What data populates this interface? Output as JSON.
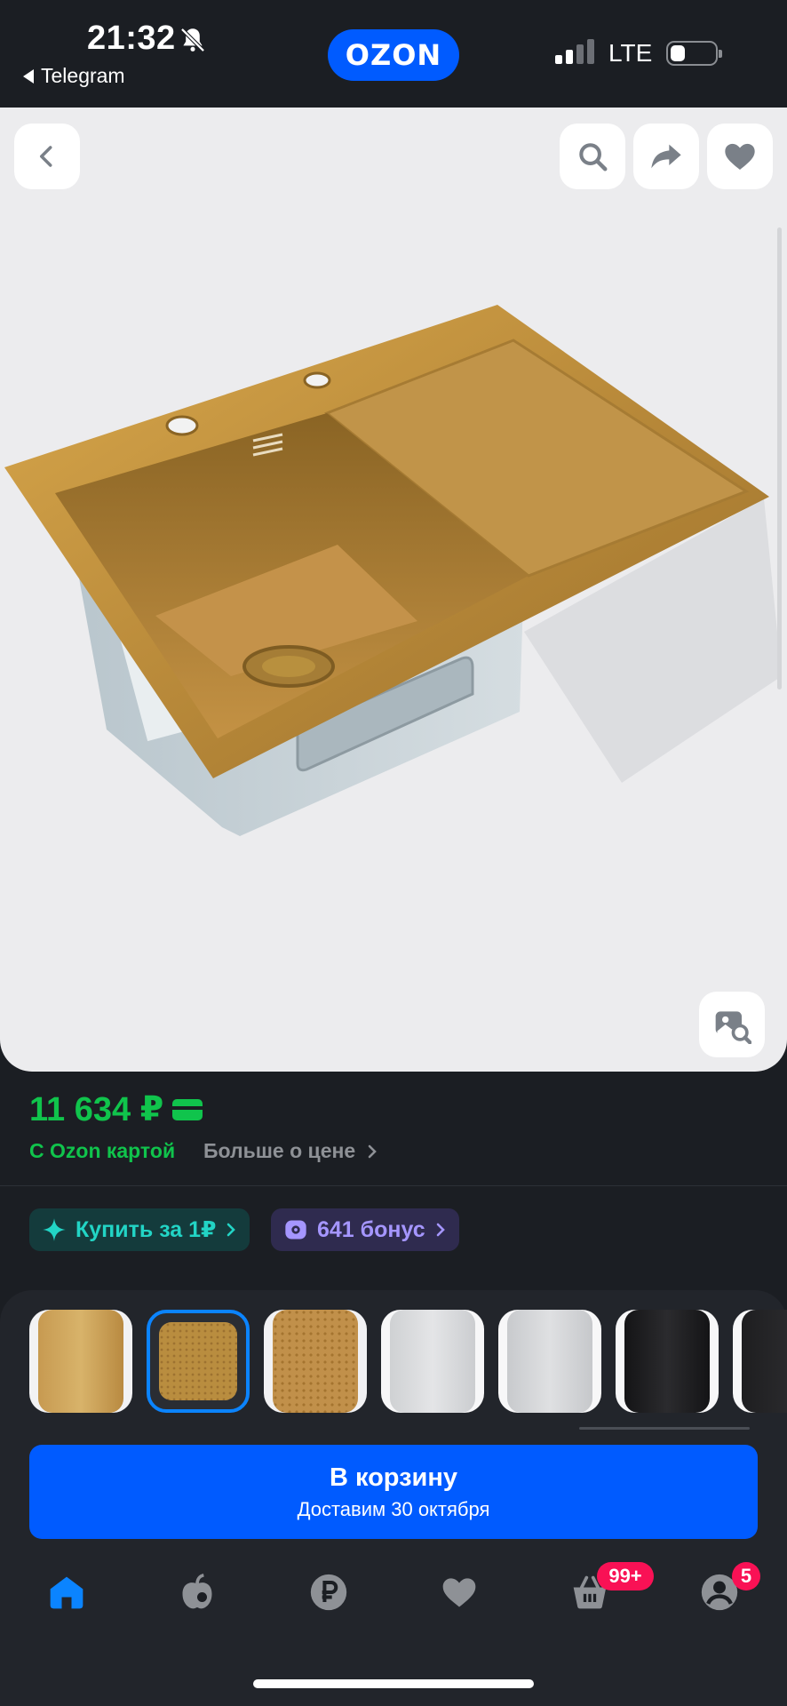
{
  "status_bar": {
    "time": "21:32",
    "back_app": "Telegram",
    "network": "LTE",
    "brand": "OZON"
  },
  "product": {
    "price": "11 634 ₽",
    "ozon_card_label": "С Ozon картой",
    "more_price_label": "Больше о цене",
    "buy_for_one": "Купить за 1₽",
    "bonus": "641 бонус"
  },
  "variants": [
    {
      "color": "#c9a45c"
    },
    {
      "color": "#b98d3f",
      "selected": true
    },
    {
      "color": "#c1904a"
    },
    {
      "color": "#d9dadc"
    },
    {
      "color": "#d3d4d6"
    },
    {
      "color": "#1c1c1e"
    },
    {
      "color": "#2a2a2c"
    }
  ],
  "cart_button": {
    "label": "В корзину",
    "delivery": "Доставим 30 октября"
  },
  "tabbar": {
    "cart_badge": "99+",
    "profile_badge": "5",
    "active_color": "#0b84ff",
    "inactive_color": "#8e9196"
  }
}
